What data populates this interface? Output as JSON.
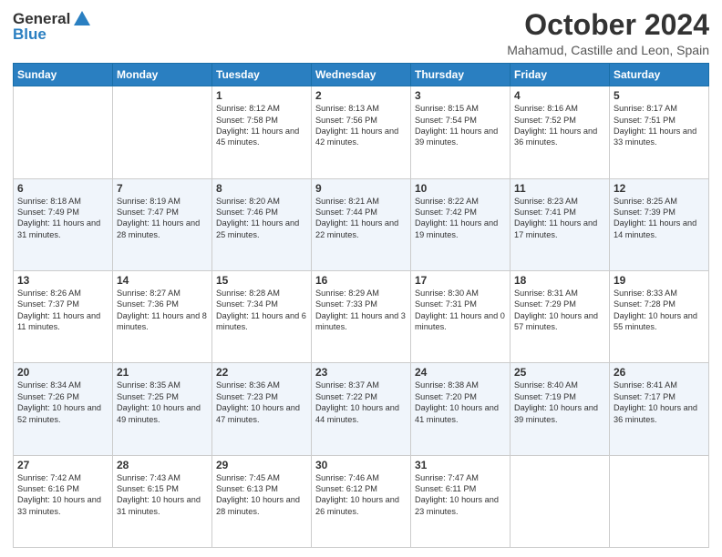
{
  "logo": {
    "general": "General",
    "blue": "Blue"
  },
  "header": {
    "title": "October 2024",
    "subtitle": "Mahamud, Castille and Leon, Spain"
  },
  "weekdays": [
    "Sunday",
    "Monday",
    "Tuesday",
    "Wednesday",
    "Thursday",
    "Friday",
    "Saturday"
  ],
  "weeks": [
    [
      null,
      null,
      {
        "day": 1,
        "sunrise": "Sunrise: 8:12 AM",
        "sunset": "Sunset: 7:58 PM",
        "daylight": "Daylight: 11 hours and 45 minutes."
      },
      {
        "day": 2,
        "sunrise": "Sunrise: 8:13 AM",
        "sunset": "Sunset: 7:56 PM",
        "daylight": "Daylight: 11 hours and 42 minutes."
      },
      {
        "day": 3,
        "sunrise": "Sunrise: 8:15 AM",
        "sunset": "Sunset: 7:54 PM",
        "daylight": "Daylight: 11 hours and 39 minutes."
      },
      {
        "day": 4,
        "sunrise": "Sunrise: 8:16 AM",
        "sunset": "Sunset: 7:52 PM",
        "daylight": "Daylight: 11 hours and 36 minutes."
      },
      {
        "day": 5,
        "sunrise": "Sunrise: 8:17 AM",
        "sunset": "Sunset: 7:51 PM",
        "daylight": "Daylight: 11 hours and 33 minutes."
      }
    ],
    [
      {
        "day": 6,
        "sunrise": "Sunrise: 8:18 AM",
        "sunset": "Sunset: 7:49 PM",
        "daylight": "Daylight: 11 hours and 31 minutes."
      },
      {
        "day": 7,
        "sunrise": "Sunrise: 8:19 AM",
        "sunset": "Sunset: 7:47 PM",
        "daylight": "Daylight: 11 hours and 28 minutes."
      },
      {
        "day": 8,
        "sunrise": "Sunrise: 8:20 AM",
        "sunset": "Sunset: 7:46 PM",
        "daylight": "Daylight: 11 hours and 25 minutes."
      },
      {
        "day": 9,
        "sunrise": "Sunrise: 8:21 AM",
        "sunset": "Sunset: 7:44 PM",
        "daylight": "Daylight: 11 hours and 22 minutes."
      },
      {
        "day": 10,
        "sunrise": "Sunrise: 8:22 AM",
        "sunset": "Sunset: 7:42 PM",
        "daylight": "Daylight: 11 hours and 19 minutes."
      },
      {
        "day": 11,
        "sunrise": "Sunrise: 8:23 AM",
        "sunset": "Sunset: 7:41 PM",
        "daylight": "Daylight: 11 hours and 17 minutes."
      },
      {
        "day": 12,
        "sunrise": "Sunrise: 8:25 AM",
        "sunset": "Sunset: 7:39 PM",
        "daylight": "Daylight: 11 hours and 14 minutes."
      }
    ],
    [
      {
        "day": 13,
        "sunrise": "Sunrise: 8:26 AM",
        "sunset": "Sunset: 7:37 PM",
        "daylight": "Daylight: 11 hours and 11 minutes."
      },
      {
        "day": 14,
        "sunrise": "Sunrise: 8:27 AM",
        "sunset": "Sunset: 7:36 PM",
        "daylight": "Daylight: 11 hours and 8 minutes."
      },
      {
        "day": 15,
        "sunrise": "Sunrise: 8:28 AM",
        "sunset": "Sunset: 7:34 PM",
        "daylight": "Daylight: 11 hours and 6 minutes."
      },
      {
        "day": 16,
        "sunrise": "Sunrise: 8:29 AM",
        "sunset": "Sunset: 7:33 PM",
        "daylight": "Daylight: 11 hours and 3 minutes."
      },
      {
        "day": 17,
        "sunrise": "Sunrise: 8:30 AM",
        "sunset": "Sunset: 7:31 PM",
        "daylight": "Daylight: 11 hours and 0 minutes."
      },
      {
        "day": 18,
        "sunrise": "Sunrise: 8:31 AM",
        "sunset": "Sunset: 7:29 PM",
        "daylight": "Daylight: 10 hours and 57 minutes."
      },
      {
        "day": 19,
        "sunrise": "Sunrise: 8:33 AM",
        "sunset": "Sunset: 7:28 PM",
        "daylight": "Daylight: 10 hours and 55 minutes."
      }
    ],
    [
      {
        "day": 20,
        "sunrise": "Sunrise: 8:34 AM",
        "sunset": "Sunset: 7:26 PM",
        "daylight": "Daylight: 10 hours and 52 minutes."
      },
      {
        "day": 21,
        "sunrise": "Sunrise: 8:35 AM",
        "sunset": "Sunset: 7:25 PM",
        "daylight": "Daylight: 10 hours and 49 minutes."
      },
      {
        "day": 22,
        "sunrise": "Sunrise: 8:36 AM",
        "sunset": "Sunset: 7:23 PM",
        "daylight": "Daylight: 10 hours and 47 minutes."
      },
      {
        "day": 23,
        "sunrise": "Sunrise: 8:37 AM",
        "sunset": "Sunset: 7:22 PM",
        "daylight": "Daylight: 10 hours and 44 minutes."
      },
      {
        "day": 24,
        "sunrise": "Sunrise: 8:38 AM",
        "sunset": "Sunset: 7:20 PM",
        "daylight": "Daylight: 10 hours and 41 minutes."
      },
      {
        "day": 25,
        "sunrise": "Sunrise: 8:40 AM",
        "sunset": "Sunset: 7:19 PM",
        "daylight": "Daylight: 10 hours and 39 minutes."
      },
      {
        "day": 26,
        "sunrise": "Sunrise: 8:41 AM",
        "sunset": "Sunset: 7:17 PM",
        "daylight": "Daylight: 10 hours and 36 minutes."
      }
    ],
    [
      {
        "day": 27,
        "sunrise": "Sunrise: 7:42 AM",
        "sunset": "Sunset: 6:16 PM",
        "daylight": "Daylight: 10 hours and 33 minutes."
      },
      {
        "day": 28,
        "sunrise": "Sunrise: 7:43 AM",
        "sunset": "Sunset: 6:15 PM",
        "daylight": "Daylight: 10 hours and 31 minutes."
      },
      {
        "day": 29,
        "sunrise": "Sunrise: 7:45 AM",
        "sunset": "Sunset: 6:13 PM",
        "daylight": "Daylight: 10 hours and 28 minutes."
      },
      {
        "day": 30,
        "sunrise": "Sunrise: 7:46 AM",
        "sunset": "Sunset: 6:12 PM",
        "daylight": "Daylight: 10 hours and 26 minutes."
      },
      {
        "day": 31,
        "sunrise": "Sunrise: 7:47 AM",
        "sunset": "Sunset: 6:11 PM",
        "daylight": "Daylight: 10 hours and 23 minutes."
      },
      null,
      null
    ]
  ]
}
